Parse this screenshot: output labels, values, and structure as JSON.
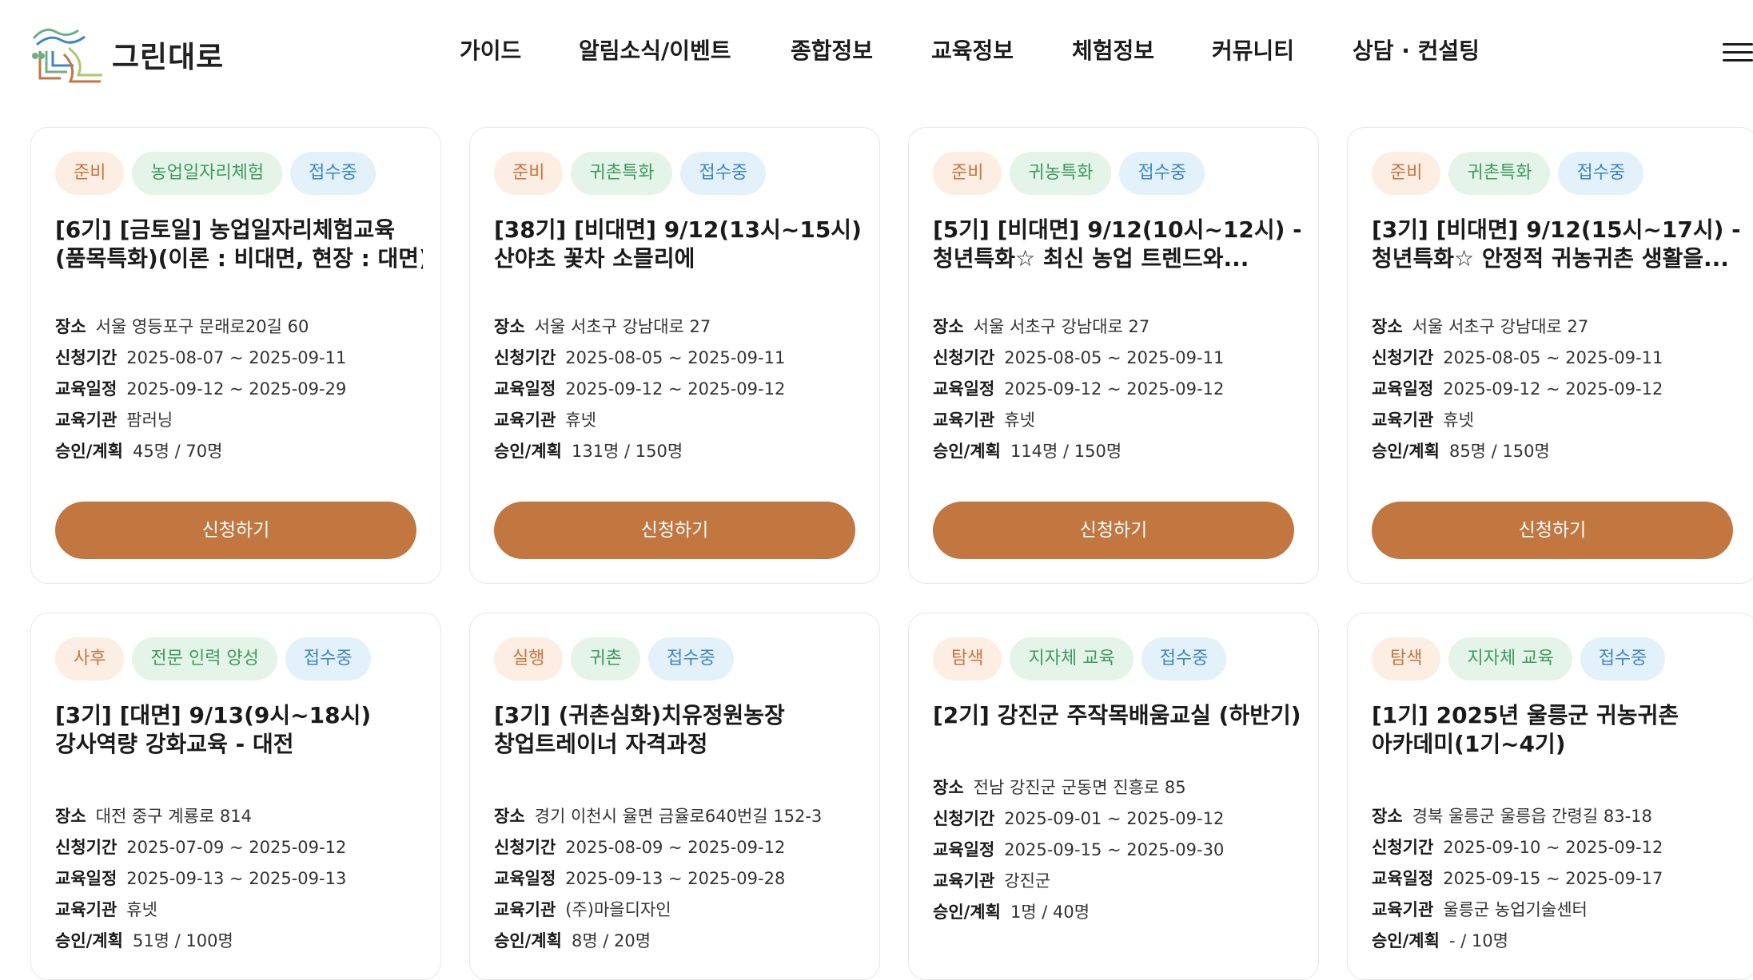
{
  "header": {
    "logo_text": "그린대로",
    "nav": [
      {
        "label": "가이드"
      },
      {
        "label": "알림소식/이벤트"
      },
      {
        "label": "종합정보"
      },
      {
        "label": "교육정보"
      },
      {
        "label": "체험정보"
      },
      {
        "label": "커뮤니티"
      },
      {
        "label": "상담 · 컨설팅"
      }
    ],
    "menu_icon": "hamburger-menu-icon"
  },
  "labels": {
    "place": "장소",
    "apply_period": "신청기간",
    "edu_schedule": "교육일정",
    "institution": "교육기관",
    "approval": "승인/계획",
    "apply_button": "신청하기"
  },
  "colors": {
    "accent": "#c27640",
    "stage_tag_bg": "#fdeee3",
    "category_tag_bg": "#e4f4e9",
    "status_tag_bg": "#e3f1fb"
  },
  "cards": [
    {
      "stage": "준비",
      "category": "농업일자리체험",
      "status": "접수중",
      "title_line1": "[6기] [금토일] 농업일자리체험교육",
      "title_line2": "(품목특화)(이론 : 비대면, 현장 : 대면)",
      "place": "서울 영등포구 문래로20길 60",
      "apply_period": "2025-08-07 ~ 2025-09-11",
      "edu_schedule": "2025-09-12 ~ 2025-09-29",
      "institution": "팜러닝",
      "approval": "45명 / 70명"
    },
    {
      "stage": "준비",
      "category": "귀촌특화",
      "status": "접수중",
      "title_line1": "[38기] [비대면] 9/12(13시~15시) -",
      "title_line2": "산야초 꽃차 소믈리에",
      "place": "서울 서초구 강남대로 27",
      "apply_period": "2025-08-05 ~ 2025-09-11",
      "edu_schedule": "2025-09-12 ~ 2025-09-12",
      "institution": "휴넷",
      "approval": "131명 / 150명"
    },
    {
      "stage": "준비",
      "category": "귀농특화",
      "status": "접수중",
      "title_line1": "[5기] [비대면] 9/12(10시~12시) - ☆",
      "title_line2": "청년특화☆ 최신 농업 트렌드와...",
      "place": "서울 서초구 강남대로 27",
      "apply_period": "2025-08-05 ~ 2025-09-11",
      "edu_schedule": "2025-09-12 ~ 2025-09-12",
      "institution": "휴넷",
      "approval": "114명 / 150명"
    },
    {
      "stage": "준비",
      "category": "귀촌특화",
      "status": "접수중",
      "title_line1": "[3기] [비대면] 9/12(15시~17시) - ☆",
      "title_line2": "청년특화☆ 안정적 귀농귀촌 생활을...",
      "place": "서울 서초구 강남대로 27",
      "apply_period": "2025-08-05 ~ 2025-09-11",
      "edu_schedule": "2025-09-12 ~ 2025-09-12",
      "institution": "휴넷",
      "approval": "85명 / 150명"
    },
    {
      "stage": "사후",
      "category": "전문 인력 양성",
      "status": "접수중",
      "title_line1": "[3기] [대면] 9/13(9시~18시)",
      "title_line2": "강사역량 강화교육 - 대전",
      "place": "대전 중구 계룡로 814",
      "apply_period": "2025-07-09 ~ 2025-09-12",
      "edu_schedule": "2025-09-13 ~ 2025-09-13",
      "institution": "휴넷",
      "approval": "51명 / 100명"
    },
    {
      "stage": "실행",
      "category": "귀촌",
      "status": "접수중",
      "title_line1": "[3기] (귀촌심화)치유정원농장",
      "title_line2": "창업트레이너 자격과정",
      "place": "경기 이천시 율면 금율로640번길 152-3",
      "apply_period": "2025-08-09 ~ 2025-09-12",
      "edu_schedule": "2025-09-13 ~ 2025-09-28",
      "institution": "(주)마을디자인",
      "approval": "8명 / 20명"
    },
    {
      "stage": "탐색",
      "category": "지자체 교육",
      "status": "접수중",
      "title_line1": "[2기] 강진군 주작목배움교실 (하반기)",
      "title_line2": "",
      "place": "전남 강진군 군동면 진흥로 85",
      "apply_period": "2025-09-01 ~ 2025-09-12",
      "edu_schedule": "2025-09-15 ~ 2025-09-30",
      "institution": "강진군",
      "approval": "1명 / 40명"
    },
    {
      "stage": "탐색",
      "category": "지자체 교육",
      "status": "접수중",
      "title_line1": "[1기] 2025년 울릉군 귀농귀촌",
      "title_line2": "아카데미(1기~4기)",
      "place": "경북 울릉군 울릉읍 간령길 83-18",
      "apply_period": "2025-09-10 ~ 2025-09-12",
      "edu_schedule": "2025-09-15 ~ 2025-09-17",
      "institution": "울릉군 농업기술센터",
      "approval": "- / 10명"
    }
  ]
}
